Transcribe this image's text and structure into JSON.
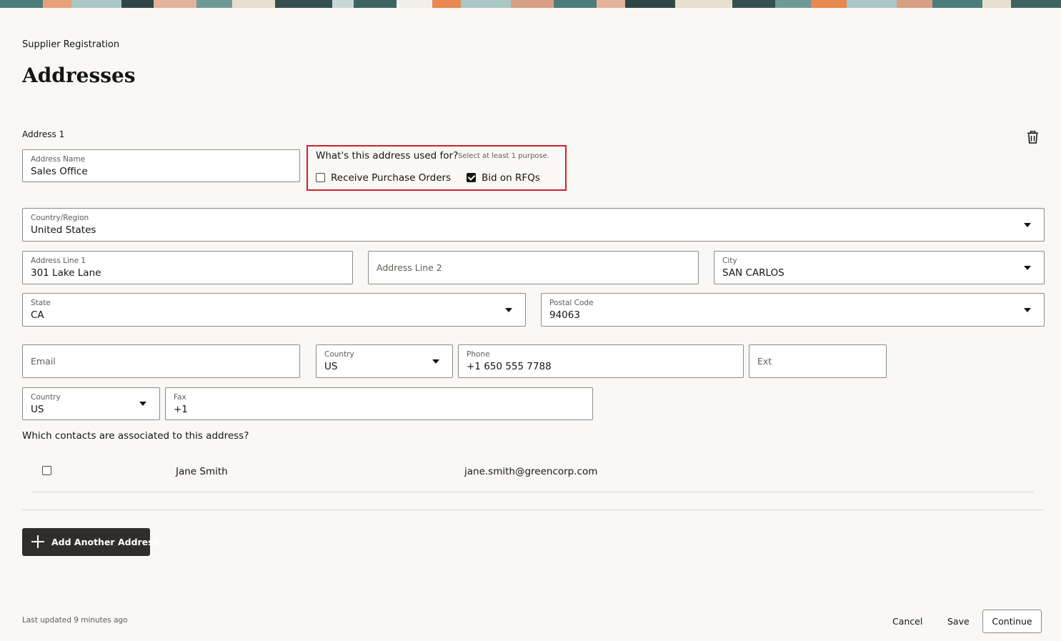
{
  "header": {
    "breadcrumb": "Supplier Registration",
    "title": "Addresses"
  },
  "address": {
    "section_label": "Address 1",
    "name": {
      "label": "Address Name",
      "value": "Sales Office"
    },
    "purpose": {
      "question": "What's this address used for?",
      "hint": "Select at least 1 purpose.",
      "options": [
        {
          "label": "Receive Purchase Orders",
          "checked": false
        },
        {
          "label": "Bid on RFQs",
          "checked": true
        }
      ]
    },
    "country_region": {
      "label": "Country/Region",
      "value": "United States"
    },
    "line1": {
      "label": "Address Line 1",
      "value": "301 Lake Lane"
    },
    "line2": {
      "placeholder": "Address Line 2"
    },
    "city": {
      "label": "City",
      "value": "SAN CARLOS"
    },
    "state": {
      "label": "State",
      "value": "CA"
    },
    "postal": {
      "label": "Postal Code",
      "value": "94063"
    },
    "email": {
      "placeholder": "Email"
    },
    "phone_country": {
      "label": "Country",
      "value": "US"
    },
    "phone": {
      "label": "Phone",
      "value": "+1 650 555 7788"
    },
    "ext": {
      "placeholder": "Ext"
    },
    "fax_country": {
      "label": "Country",
      "value": "US"
    },
    "fax": {
      "label": "Fax",
      "value": "+1"
    }
  },
  "contacts": {
    "question": "Which contacts are associated to this address?",
    "rows": [
      {
        "name": "Jane Smith",
        "email": "jane.smith@greencorp.com",
        "checked": false
      }
    ]
  },
  "actions": {
    "add_address": "Add Another Address",
    "cancel": "Cancel",
    "save": "Save",
    "continue": "Continue"
  },
  "footer": {
    "last_updated": "Last updated 9 minutes ago"
  },
  "colors": {
    "background": "#f9f8f6",
    "highlight_border": "#d0202a",
    "primary_button": "#312d2a"
  }
}
